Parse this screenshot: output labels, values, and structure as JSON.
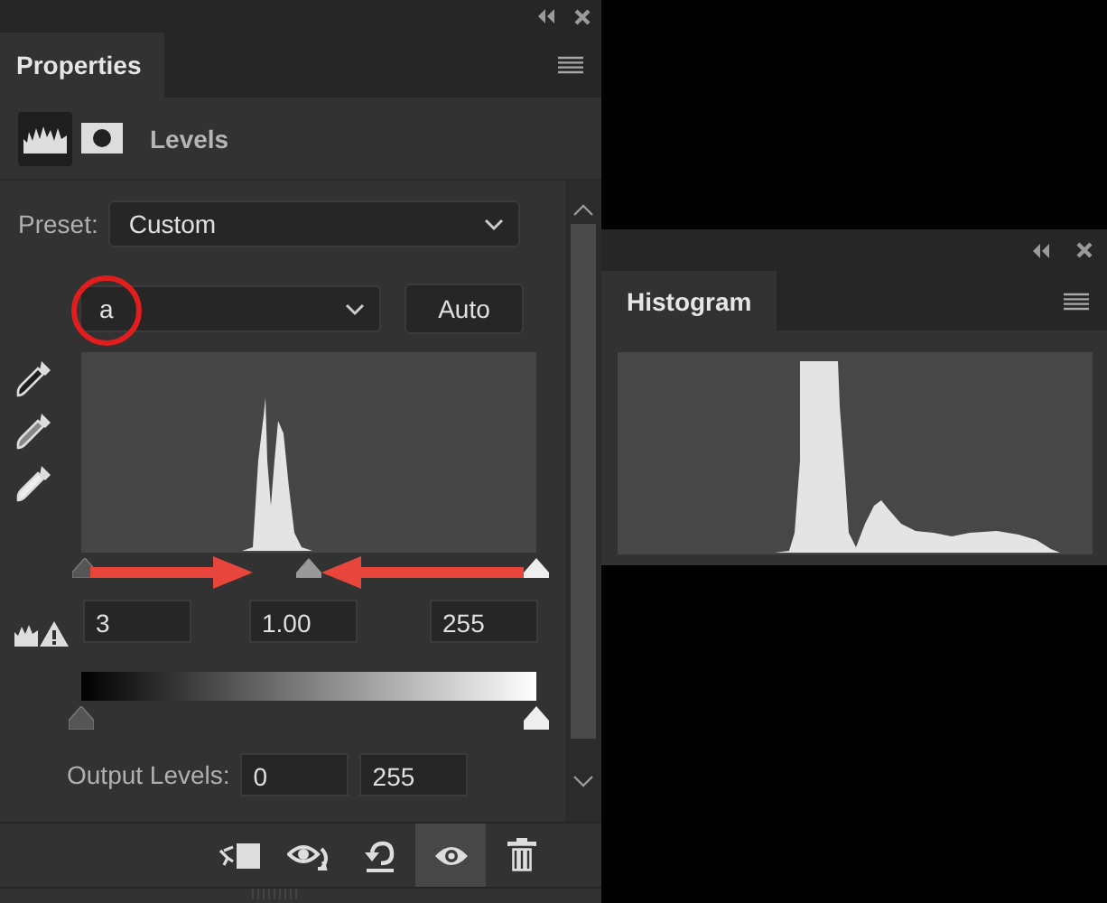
{
  "properties_panel": {
    "tab": {
      "label": "Properties",
      "selected": true
    },
    "adjustment": {
      "title": "Levels"
    },
    "preset": {
      "label": "Preset:",
      "value": "Custom"
    },
    "channel": {
      "value": "a"
    },
    "auto_button": "Auto",
    "input_levels": [
      "3",
      "1.00",
      "255"
    ],
    "output_levels": {
      "label": "Output Levels:",
      "values": [
        "0",
        "255"
      ]
    },
    "toolbar": [
      {
        "kind": "clip",
        "selected": false
      },
      {
        "kind": "previous",
        "selected": false
      },
      {
        "kind": "reset",
        "selected": false
      },
      {
        "kind": "visibility",
        "selected": true
      },
      {
        "kind": "delete",
        "selected": false
      }
    ]
  },
  "histogram_panel": {
    "tab": {
      "label": "Histogram",
      "selected": true
    }
  }
}
